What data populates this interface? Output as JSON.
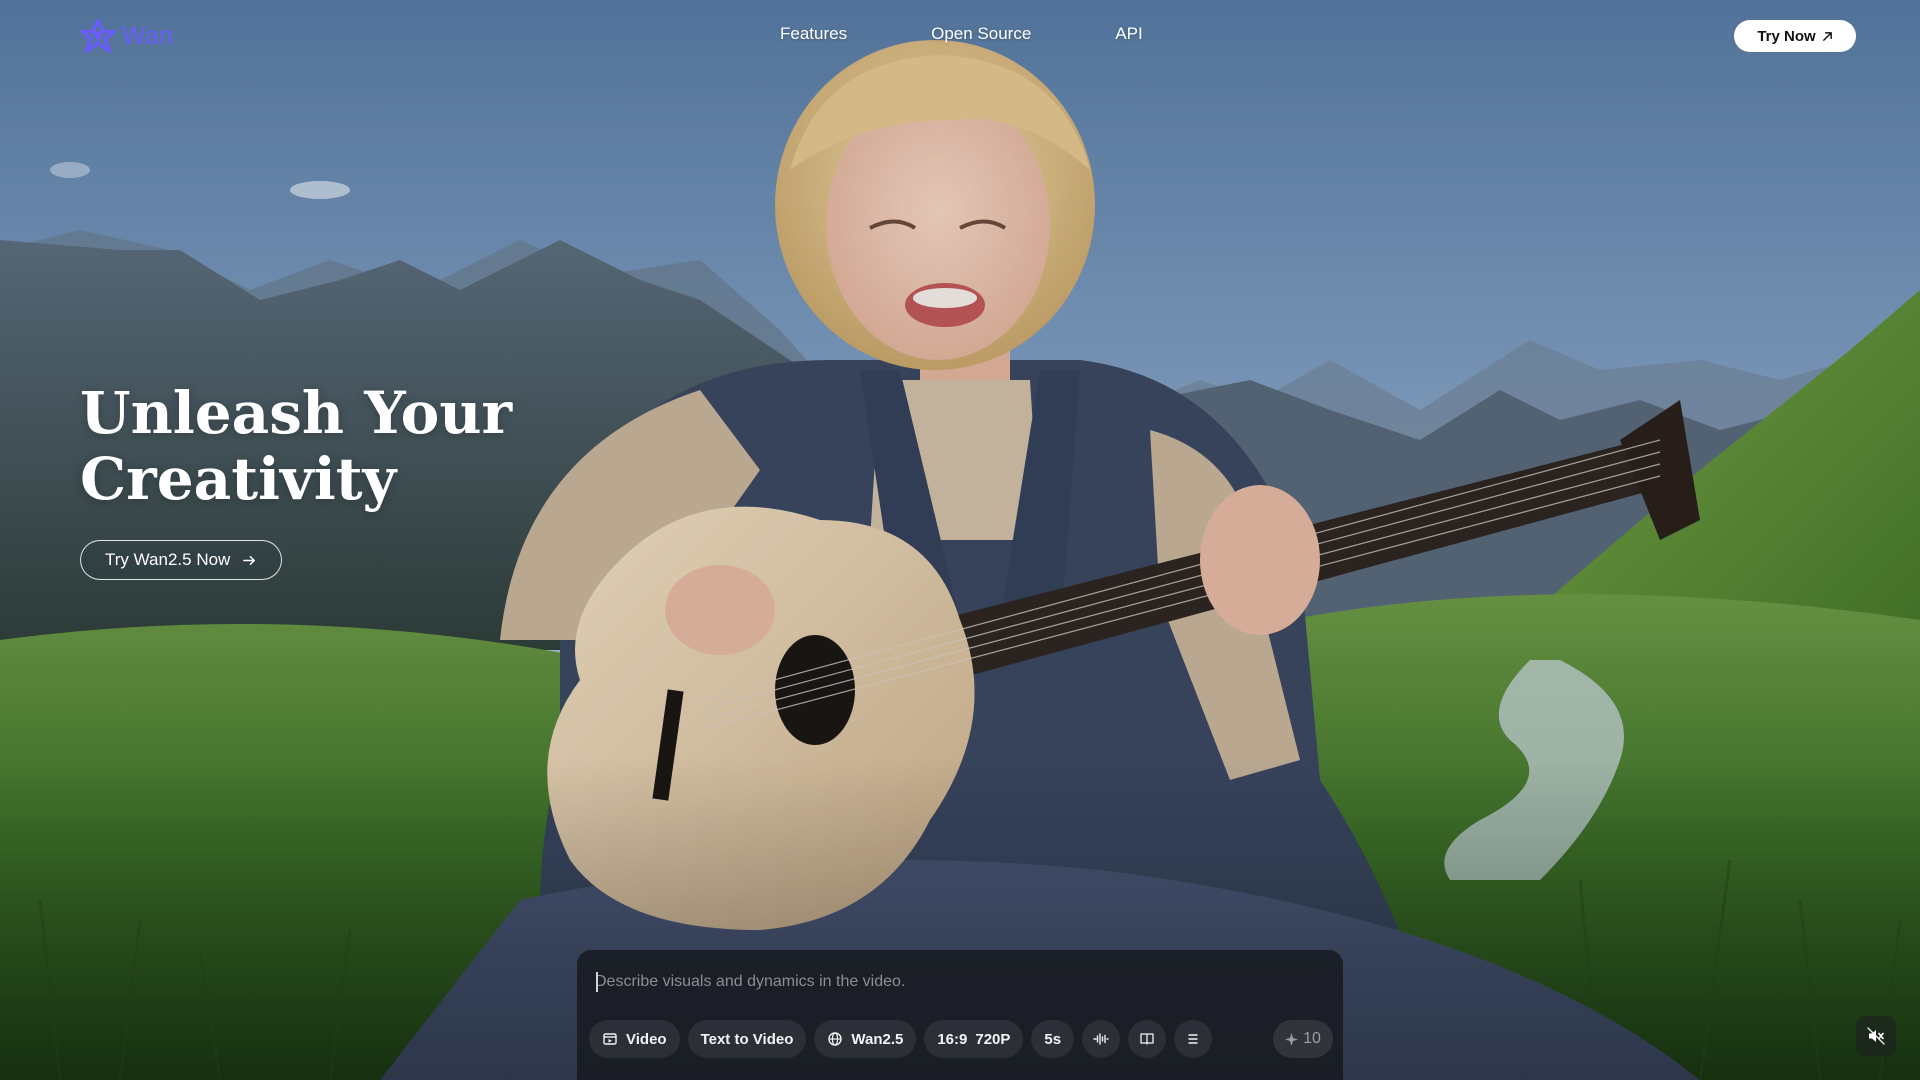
{
  "brand": {
    "name": "Wan",
    "color": "#6b5cff"
  },
  "nav": {
    "links": [
      "Features",
      "Open Source",
      "API"
    ],
    "cta_label": "Try Now"
  },
  "hero": {
    "title_line1": "Unleash Your",
    "title_line2": "Creativity",
    "cta_label": "Try Wan2.5 Now"
  },
  "prompt": {
    "placeholder": "Describe visuals and dynamics in the video.",
    "value": "",
    "toolbar": {
      "mode_label": "Video",
      "type_label": "Text to Video",
      "model_label": "Wan2.5",
      "aspect_label": "16:9",
      "resolution_label": "720P",
      "duration_label": "5s",
      "audio_icon": "waveform-icon",
      "book_icon": "book-icon",
      "menu_icon": "menu-lines-icon"
    },
    "credits": "10"
  },
  "icons": {
    "external": "arrow-up-right-icon",
    "cta_arrow": "arrow-right-icon",
    "mute": "speaker-muted-icon"
  },
  "colors": {
    "panel_bg": "#181a20",
    "accent": "#6b5cff"
  }
}
